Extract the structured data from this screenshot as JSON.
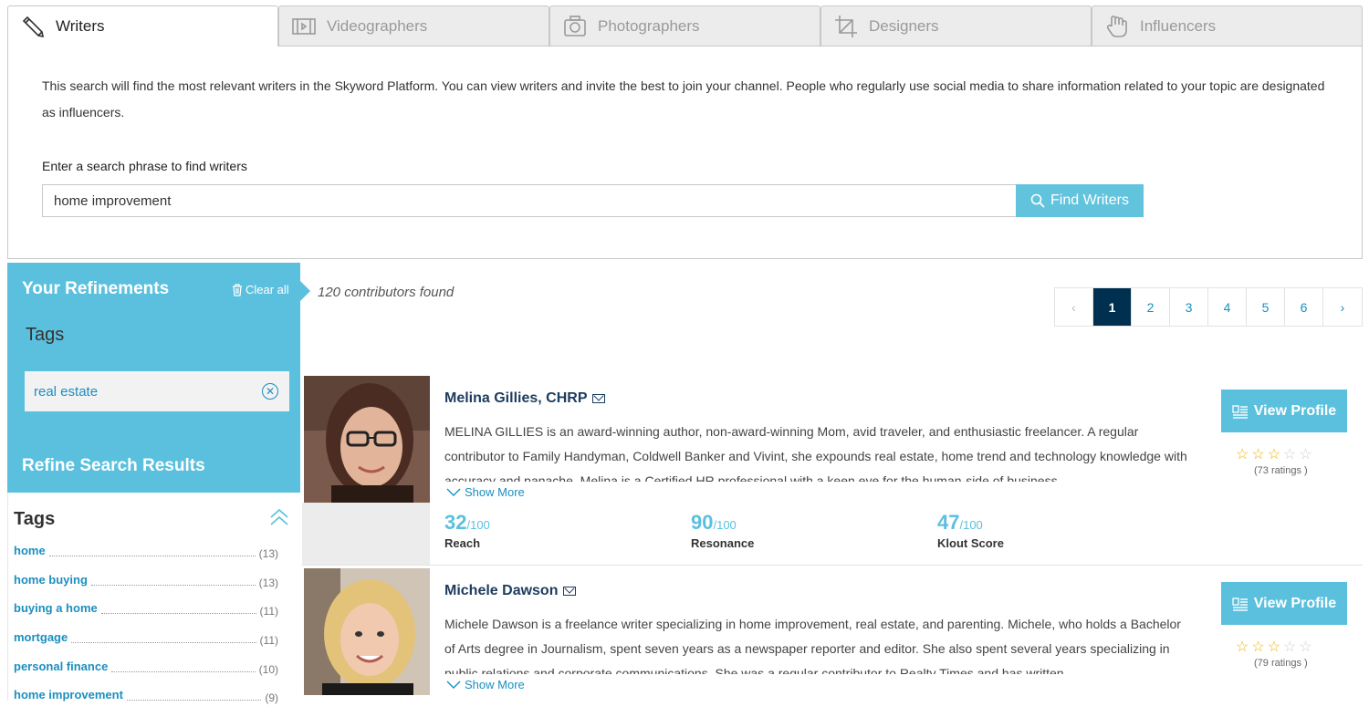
{
  "tabs": [
    {
      "label": "Writers",
      "icon": "pencil-icon",
      "active": true
    },
    {
      "label": "Videographers",
      "icon": "film-icon",
      "active": false
    },
    {
      "label": "Photographers",
      "icon": "camera-icon",
      "active": false
    },
    {
      "label": "Designers",
      "icon": "crop-icon",
      "active": false
    },
    {
      "label": "Influencers",
      "icon": "hand-icon",
      "active": false
    }
  ],
  "search": {
    "intro": "This search will find the most relevant writers in the Skyword Platform. You can view writers and invite the best to join your channel. People who regularly use social media to share information related to your topic are designated as influencers.",
    "label": "Enter a search phrase to find writers",
    "value": "home improvement",
    "button_label": "Find Writers"
  },
  "refinements": {
    "title": "Your Refinements",
    "clear_label": "Clear all",
    "tags_heading": "Tags",
    "active_tag": "real estate",
    "refine_title": "Refine Search Results"
  },
  "tag_filter": {
    "heading": "Tags",
    "items": [
      {
        "name": "home",
        "count": "(13)"
      },
      {
        "name": "home buying",
        "count": "(13)"
      },
      {
        "name": "buying a home",
        "count": "(11)"
      },
      {
        "name": "mortgage",
        "count": "(11)"
      },
      {
        "name": "personal finance",
        "count": "(10)"
      },
      {
        "name": "home improvement",
        "count": "(9)"
      }
    ]
  },
  "results": {
    "found_text": "120 contributors found",
    "pagination": {
      "pages": [
        "1",
        "2",
        "3",
        "4",
        "5",
        "6"
      ],
      "current": "1",
      "prev": "‹",
      "next": "›"
    },
    "cards": [
      {
        "name": "Melina Gillies, CHRP",
        "bio": "MELINA GILLIES is an award-winning author, non-award-winning Mom, avid traveler, and enthusiastic freelancer. A regular contributor to Family Handyman, Coldwell Banker and Vivint, she expounds real estate, home trend and technology knowledge with accuracy and panache. Melina is a Certified HR professional with a keen eye for the human-side of business.",
        "show_more": "Show More",
        "metrics": [
          {
            "value": "32",
            "denom": "/100",
            "label": "Reach"
          },
          {
            "value": "90",
            "denom": "/100",
            "label": "Resonance"
          },
          {
            "value": "47",
            "denom": "/100",
            "label": "Klout Score"
          }
        ],
        "button_label": "View Profile",
        "rating": 3,
        "ratings_text": "(73 ratings )"
      },
      {
        "name": "Michele Dawson",
        "bio": "Michele Dawson is a freelance writer specializing in home improvement, real estate, and parenting. Michele, who holds a Bachelor of Arts degree in Journalism, spent seven years as a newspaper reporter and editor. She also spent several years specializing in public relations and corporate communications. She was a regular contributor to Realty Times and has written",
        "show_more": "Show More",
        "button_label": "View Profile",
        "rating": 3,
        "ratings_text": "(79 ratings )"
      }
    ]
  },
  "colors": {
    "accent": "#5bc0de",
    "link": "#1b8fc0",
    "active_page": "#003050",
    "star": "#f0b400"
  }
}
